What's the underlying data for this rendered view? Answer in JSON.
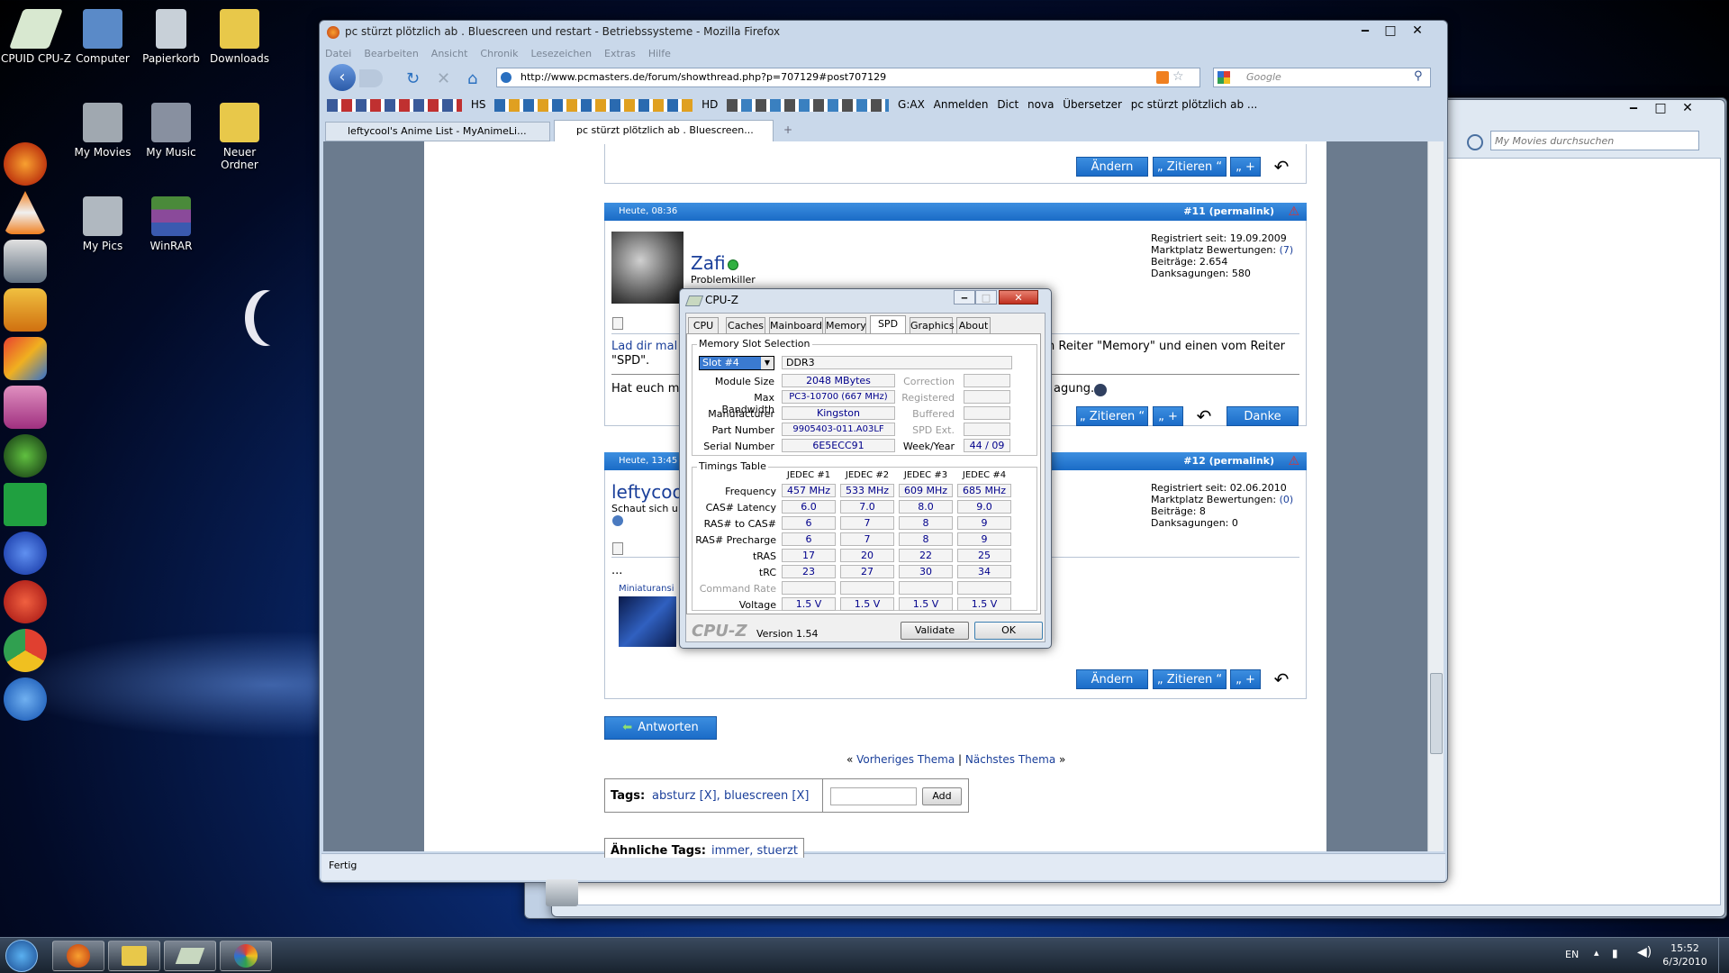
{
  "desktop": {
    "icons": [
      {
        "label": "CPUID CPU-Z",
        "color": "#d8e8d0"
      },
      {
        "label": "Computer",
        "color": "#5a8ac8"
      },
      {
        "label": "Papierkorb",
        "color": "#c8d0d8"
      },
      {
        "label": "Downloads",
        "color": "#e8c84a"
      },
      {
        "label": "My Movies",
        "color": "#a0a8b0"
      },
      {
        "label": "My Music",
        "color": "#8890a0"
      },
      {
        "label": "Neuer Ordner",
        "color": "#e8c84a"
      },
      {
        "label": "My Pics",
        "color": "#b0b8c0"
      },
      {
        "label": "WinRAR",
        "color": "#8a4a9a"
      }
    ]
  },
  "firefox": {
    "title": "pc stürzt plötzlich ab . Bluescreen und restart - Betriebssysteme - Mozilla Firefox",
    "menu": [
      "Datei",
      "Bearbeiten",
      "Ansicht",
      "Chronik",
      "Lesezeichen",
      "Extras",
      "Hilfe"
    ],
    "url": "http://www.pcmasters.de/forum/showthread.php?p=707129#post707129",
    "search_placeholder": "Google",
    "bookmarks": [
      "HS",
      "HD",
      "G:AX",
      "Anmelden",
      "Dict",
      "nova",
      "Übersetzer",
      "pc stürzt plötzlich ab ..."
    ],
    "tabs": [
      "leftycool's Anime List - MyAnimeLi...",
      "pc stürzt plötzlich ab . Bluescreen..."
    ],
    "status": "Fertig"
  },
  "forum": {
    "btn_aendern": "Ändern",
    "btn_zitieren": "„ Zitieren “",
    "btn_plus": "„ +",
    "btn_danke": "Danke",
    "btn_antworten": "Antworten",
    "post11": {
      "date": "Heute, 08:36",
      "num": "#11 (permalink)",
      "user": "Zafi",
      "title": "Problemkiller",
      "reg": "Registriert seit: 19.09.2009",
      "markt": "Marktplatz Bewertungen:",
      "markt_val": "(7)",
      "beitraege": "Beiträge: 2.654",
      "dank": "Danksagungen: 580",
      "text1": "Lad dir mal",
      "text1b": "n Reiter \"Memory\" und einen vom Reiter",
      "text2": "\"SPD\".",
      "text3": "Hat euch m",
      "text3b": "agung."
    },
    "post12": {
      "date": "Heute, 13:45",
      "num": "#12 (permalink)",
      "user": "leftycoo",
      "sub": "Schaut sich u",
      "reg": "Registriert seit: 02.06.2010",
      "markt": "Marktplatz Bewertungen:",
      "markt_val": "(0)",
      "beitraege": "Beiträge: 8",
      "dank": "Danksagungen: 0",
      "dots": "...",
      "thumb": "Miniaturansi"
    },
    "nav_prev": "Vorheriges Thema",
    "nav_sep": "|",
    "nav_next": "Nächstes Thema",
    "tags_label": "Tags:",
    "tags": "absturz [X], bluescreen [X]",
    "tags_add": "Add",
    "similar_label": "Ähnliche Tags:",
    "similar": "immer, stuerzt"
  },
  "explorer": {
    "search_placeholder": "My Movies durchsuchen"
  },
  "cpuz": {
    "title": "CPU-Z",
    "tabs": [
      "CPU",
      "Caches",
      "Mainboard",
      "Memory",
      "SPD",
      "Graphics",
      "About"
    ],
    "slot_group": "Memory Slot Selection",
    "slot": "Slot #4",
    "type": "DDR3",
    "module_size_l": "Module Size",
    "module_size": "2048 MBytes",
    "max_bw_l": "Max Bandwidth",
    "max_bw": "PC3-10700 (667 MHz)",
    "manufacturer_l": "Manufacturer",
    "manufacturer": "Kingston",
    "part_l": "Part Number",
    "part": "9905403-011.A03LF",
    "serial_l": "Serial Number",
    "serial": "6E5ECC91",
    "correction": "Correction",
    "registered": "Registered",
    "buffered": "Buffered",
    "spd_ext": "SPD Ext.",
    "week_l": "Week/Year",
    "week": "44 / 09",
    "timings_group": "Timings Table",
    "jedec": [
      "JEDEC #1",
      "JEDEC #2",
      "JEDEC #3",
      "JEDEC #4"
    ],
    "rows": [
      {
        "label": "Frequency",
        "vals": [
          "457 MHz",
          "533 MHz",
          "609 MHz",
          "685 MHz"
        ]
      },
      {
        "label": "CAS# Latency",
        "vals": [
          "6.0",
          "7.0",
          "8.0",
          "9.0"
        ]
      },
      {
        "label": "RAS# to CAS#",
        "vals": [
          "6",
          "7",
          "8",
          "9"
        ]
      },
      {
        "label": "RAS# Precharge",
        "vals": [
          "6",
          "7",
          "8",
          "9"
        ]
      },
      {
        "label": "tRAS",
        "vals": [
          "17",
          "20",
          "22",
          "25"
        ]
      },
      {
        "label": "tRC",
        "vals": [
          "23",
          "27",
          "30",
          "34"
        ]
      },
      {
        "label": "Command Rate",
        "vals": [
          "",
          "",
          "",
          ""
        ]
      },
      {
        "label": "Voltage",
        "vals": [
          "1.5 V",
          "1.5 V",
          "1.5 V",
          "1.5 V"
        ]
      }
    ],
    "logo": "CPU-Z",
    "version": "Version 1.54",
    "validate": "Validate",
    "ok": "OK"
  },
  "tray": {
    "lang": "EN",
    "time": "15:52",
    "date": "6/3/2010"
  }
}
